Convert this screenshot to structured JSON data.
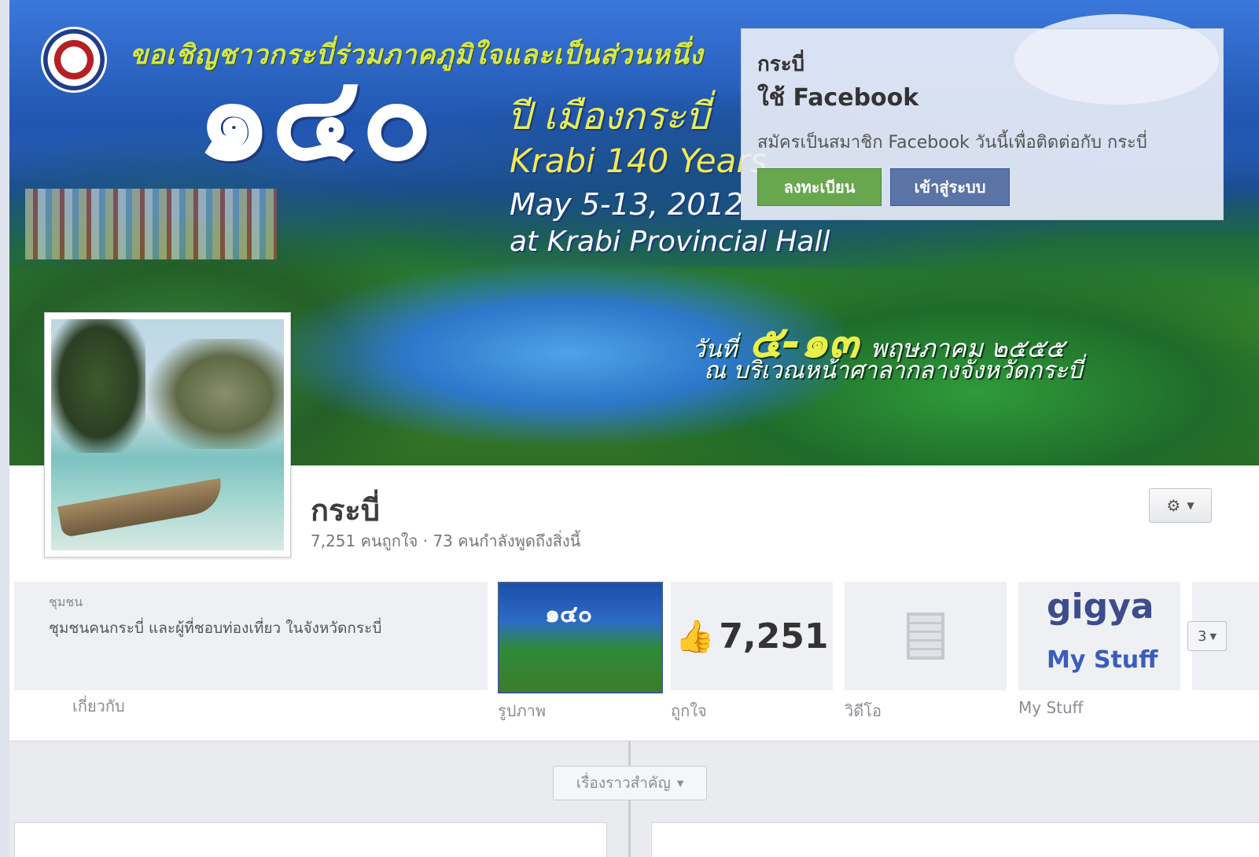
{
  "cover": {
    "banner_top": "ขอเชิญชาวกระบี่ร่วมภาคภูมิใจและเป็นส่วนหนึ่ง",
    "big_number": "๑๔๐",
    "years_thai": "ปี เมืองกระบี่",
    "event_en": "Krabi 140 Years",
    "dates_en": "May 5-13, 2012",
    "venue_en": "at Krabi Provincial Hall",
    "date_th_prefix": "วันที่",
    "date_th_range": "๕-๑๓",
    "date_th_month": "พฤษภาคม ๒๕๕๕",
    "venue_th": "ณ บริเวณหน้าศาลากลางจังหวัดกระบี่"
  },
  "popup": {
    "page_name": "กระบี่",
    "title": "ใช้ Facebook",
    "description": "สมัครเป็นสมาชิก Facebook วันนี้เพื่อติดต่อกับ กระบี่",
    "register_label": "ลงทะเบียน",
    "login_label": "เข้าสู่ระบบ"
  },
  "page": {
    "name": "กระบี่",
    "stats": "7,251 คนถูกใจ · 73 คนกำลังพูดถึงสิ่งนี้",
    "about_category": "ชุมชน",
    "about_text": "ชุมชนคนกระบี่ และผู้ที่ชอบท่องเที่ยว ในจังหวัดกระบี่",
    "about_label": "เกี่ยวกับ"
  },
  "tiles": {
    "photos_label": "รูปภาพ",
    "photos_thumb_text": "๑๔๐",
    "likes_count": "7,251",
    "likes_label": "ถูกใจ",
    "video_label": "วิดีโอ",
    "gigya_logo": "gigya",
    "gigya_sub": "My Stuff",
    "gigya_label": "My Stuff",
    "more_count": "3"
  },
  "timeline": {
    "highlights_label": "เรื่องราวสำคัญ"
  },
  "icons": {
    "gear": "gear-icon",
    "like": "thumbs-up-icon",
    "video": "film-icon",
    "dropdown": "chevron-down-icon"
  }
}
